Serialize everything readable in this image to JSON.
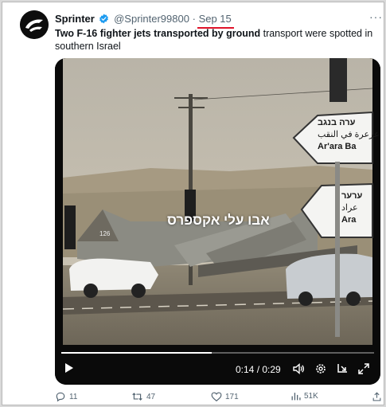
{
  "tweet": {
    "author_name": "Sprinter",
    "handle": "@Sprinter99800",
    "separator": "·",
    "date": "Sep 15",
    "text_bold": "Two F-16 fighter jets transported by ground",
    "text_rest": " transport were spotted in southern Israel",
    "more_label": "···"
  },
  "video": {
    "overlay_caption": "אבו עלי אקספרס",
    "sign_top_hebrew": "ערה בנגב",
    "sign_top_arabic": "عرعرة في النقب",
    "sign_top_latin": "Ar'ara Ba",
    "sign_bottom_hebrew": "ערער",
    "sign_bottom_arabic": "عراد",
    "sign_bottom_latin": "Ara",
    "tail_number": "126",
    "time_display": "0:14 / 0:29",
    "progress": 0.48
  },
  "actions": {
    "replies": "11",
    "reposts": "47",
    "likes": "171",
    "views": "51K"
  },
  "colors": {
    "accent_underline": "#e0142a",
    "verified": "#1d9bf0",
    "muted": "#536471"
  }
}
